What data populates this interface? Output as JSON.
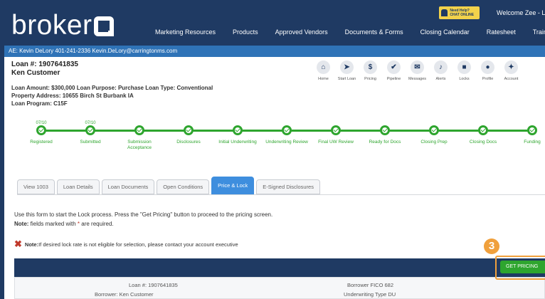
{
  "header": {
    "logo_text": "broker",
    "logo_bold": "IQ",
    "nav": [
      "Marketing Resources",
      "Products",
      "Approved Vendors",
      "Documents & Forms",
      "Closing Calendar",
      "Ratesheet",
      "Training"
    ],
    "chat_badge": "Need Help? CHAT ONLINE",
    "welcome": "Welcome Zee - Logout"
  },
  "ae_bar": "AE: Kevin DeLory 401-241-2336 Kevin.DeLory@carringtonms.com",
  "loan": {
    "number": "Loan #: 1907641835",
    "customer": "Ken Customer",
    "summary": "Loan Amount: $300,000   Loan Purpose: Purchase   Loan Type: Conventional",
    "address": "Property Address: 10655 Birch St Burbank IA",
    "program": "Loan Program: C15F"
  },
  "toolbar": [
    {
      "icon": "home-icon",
      "glyph": "⌂",
      "label": "Home"
    },
    {
      "icon": "start-loan-icon",
      "glyph": "➤",
      "label": "Start Loan"
    },
    {
      "icon": "pricing-icon",
      "glyph": "$",
      "label": "Pricing"
    },
    {
      "icon": "pipeline-icon",
      "glyph": "✔",
      "label": "Pipeline"
    },
    {
      "icon": "messages-icon",
      "glyph": "✉",
      "label": "Messages"
    },
    {
      "icon": "alerts-icon",
      "glyph": "♪",
      "label": "Alerts"
    },
    {
      "icon": "locks-icon",
      "glyph": "■",
      "label": "Locks"
    },
    {
      "icon": "profile-icon",
      "glyph": "●",
      "label": "Profile"
    },
    {
      "icon": "account-icon",
      "glyph": "✦",
      "label": "Account"
    }
  ],
  "progress": [
    {
      "date": "07/10",
      "label": "Registered"
    },
    {
      "date": "07/10",
      "label": "Submitted"
    },
    {
      "date": "",
      "label": "Submission Acceptance"
    },
    {
      "date": "",
      "label": "Disclosures"
    },
    {
      "date": "",
      "label": "Initial Underwriting"
    },
    {
      "date": "",
      "label": "Underwriting Review"
    },
    {
      "date": "",
      "label": "Final UW Review"
    },
    {
      "date": "",
      "label": "Ready for Docs"
    },
    {
      "date": "",
      "label": "Closing Prep"
    },
    {
      "date": "",
      "label": "Closing Docs"
    },
    {
      "date": "",
      "label": "Funding"
    }
  ],
  "tabs": [
    "View 1003",
    "Loan Details",
    "Loan Documents",
    "Open Conditions",
    "Price & Lock",
    "E-Signed Disclosures"
  ],
  "active_tab": 4,
  "instructions": {
    "line1": "Use this form to start the Lock process. Press the \"Get Pricing\" button to proceed to the pricing screen.",
    "note_label": "Note:",
    "note_text": " fields marked with ",
    "asterisk": "*",
    "note_tail": " are required."
  },
  "lock_note": {
    "label": "Note:",
    "text": " If desired lock rate is not eligible for selection, please contact your account executive"
  },
  "get_pricing_label": "GET PRICING",
  "callout_number": "3",
  "summary_panel": {
    "loan_no": "Loan #:  1907641835",
    "borrower": "Borrower:  Ken Customer",
    "fico": "Borrower FICO  682",
    "uw_type": "Underwriting Type  DU"
  },
  "colors": {
    "navy": "#1f3a63",
    "blue_bar": "#2f73b7",
    "green": "#2ea52e",
    "orange": "#f0a03c"
  }
}
